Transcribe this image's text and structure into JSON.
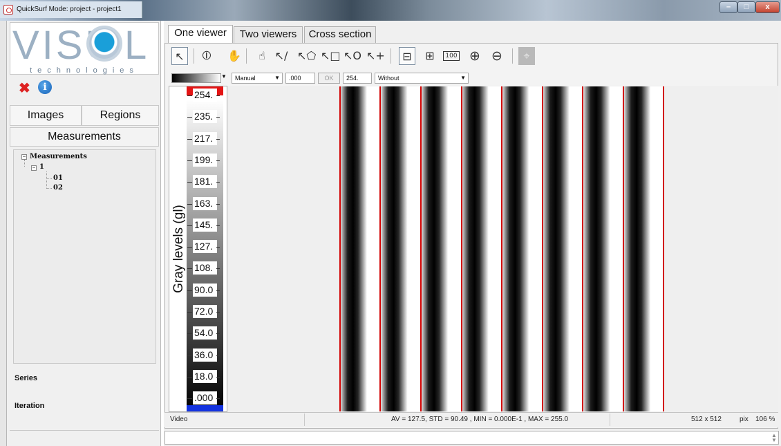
{
  "window": {
    "title": "QuickSurf Mode: project - project1",
    "minimize": "–",
    "maximize": "□",
    "close": "x"
  },
  "logo": {
    "text": "VISU",
    "text_end": "L",
    "subtitle": "technologies"
  },
  "left_panel": {
    "tabs": {
      "images": "Images",
      "regions": "Regions",
      "measurements": "Measurements"
    },
    "tree": {
      "root": "Measurements",
      "child": "1",
      "leaves": [
        "01",
        "02"
      ]
    },
    "series_label": "Series",
    "iteration_label": "Iteration"
  },
  "main_tabs": [
    "One viewer",
    "Two viewers",
    "Cross section"
  ],
  "toolbar": {
    "icons": [
      "pointer-icon",
      "range-icon",
      "pan-hand-icon",
      "point-select-icon",
      "line-tool-icon",
      "polygon-tool-icon",
      "rectangle-tool-icon",
      "ellipse-tool-icon",
      "add-point-icon",
      "fit-width-icon",
      "fit-window-icon",
      "zoom-100-icon",
      "zoom-in-icon",
      "zoom-out-icon",
      "crosshair-icon"
    ],
    "zoom_100_label": "100"
  },
  "controls": {
    "mode": "Manual",
    "min_value": ".000",
    "ok_label": "OK",
    "max_value": "254.",
    "overlay": "Without"
  },
  "scale": {
    "label": "Gray levels (gl)",
    "ticks": [
      "254.",
      "235.",
      "217.",
      "199.",
      "181.",
      "163.",
      "145.",
      "127.",
      "108.",
      "90.0",
      "72.0",
      "54.0",
      "36.0",
      "18.0",
      ".000"
    ]
  },
  "status": {
    "source": "Video",
    "stats": "AV = 127.5, STD = 90.49 , MIN = 0.000E-1 , MAX = 255.0",
    "size": "512 x 512",
    "unit": "pix",
    "zoom": "106 %"
  },
  "colors": {
    "accent_red": "#d20000",
    "scale_max": "#e41414",
    "scale_min": "#1433e0",
    "logo_blue": "#1a9fd9"
  }
}
